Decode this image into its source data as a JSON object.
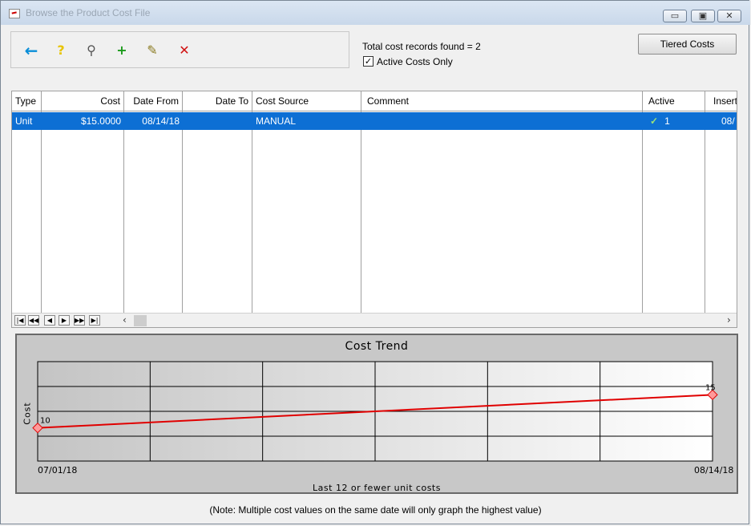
{
  "window": {
    "title": "Browse the Product Cost File",
    "min_glyph": "▭",
    "max_glyph": "▣",
    "close_glyph": "✕"
  },
  "toolbar": {
    "back_glyph": "←",
    "back_icon": "back-arrow-icon",
    "help_glyph": "?",
    "help_icon": "help-icon",
    "find_glyph": "⚲",
    "find_icon": "find-key-icon",
    "add_glyph": "+",
    "add_icon": "add-record-icon",
    "edit_glyph": "✎",
    "edit_icon": "edit-record-icon",
    "delete_glyph": "✕",
    "delete_icon": "delete-record-icon"
  },
  "header": {
    "total_text": "Total cost records found = 2",
    "active_only_label": "Active Costs Only",
    "active_only_checked": "✓",
    "tiered_button": "Tiered Costs"
  },
  "grid": {
    "columns": [
      "Type",
      "Cost",
      "Date From",
      "Date To",
      "Cost Source",
      "Comment",
      "Active",
      "Insert"
    ],
    "rows": [
      {
        "type": "Unit",
        "cost": "$15.0000",
        "date_from": "08/14/18",
        "date_to": "",
        "cost_source": "MANUAL",
        "comment": "",
        "active_check": "✓",
        "active": "1",
        "insert": "08/"
      }
    ],
    "nav": [
      "|◀",
      "◀◀",
      "◀",
      "▶",
      "▶▶",
      "▶|"
    ],
    "scroll_left": "‹",
    "scroll_right": "›",
    "selected_color": "#0d6fd4"
  },
  "chart_data": {
    "type": "line",
    "title": "Cost Trend",
    "xlabel": "Last 12 or fewer unit costs",
    "ylabel": "Cost",
    "x": [
      "07/01/18",
      "08/14/18"
    ],
    "series": [
      {
        "values": [
          10,
          15
        ]
      }
    ],
    "point_labels": [
      "10",
      "15"
    ],
    "ylim": [
      5,
      20
    ],
    "grid": true,
    "line_color": "#e00000"
  },
  "note": "(Note:  Multiple cost values on the same date will only graph the highest value)"
}
